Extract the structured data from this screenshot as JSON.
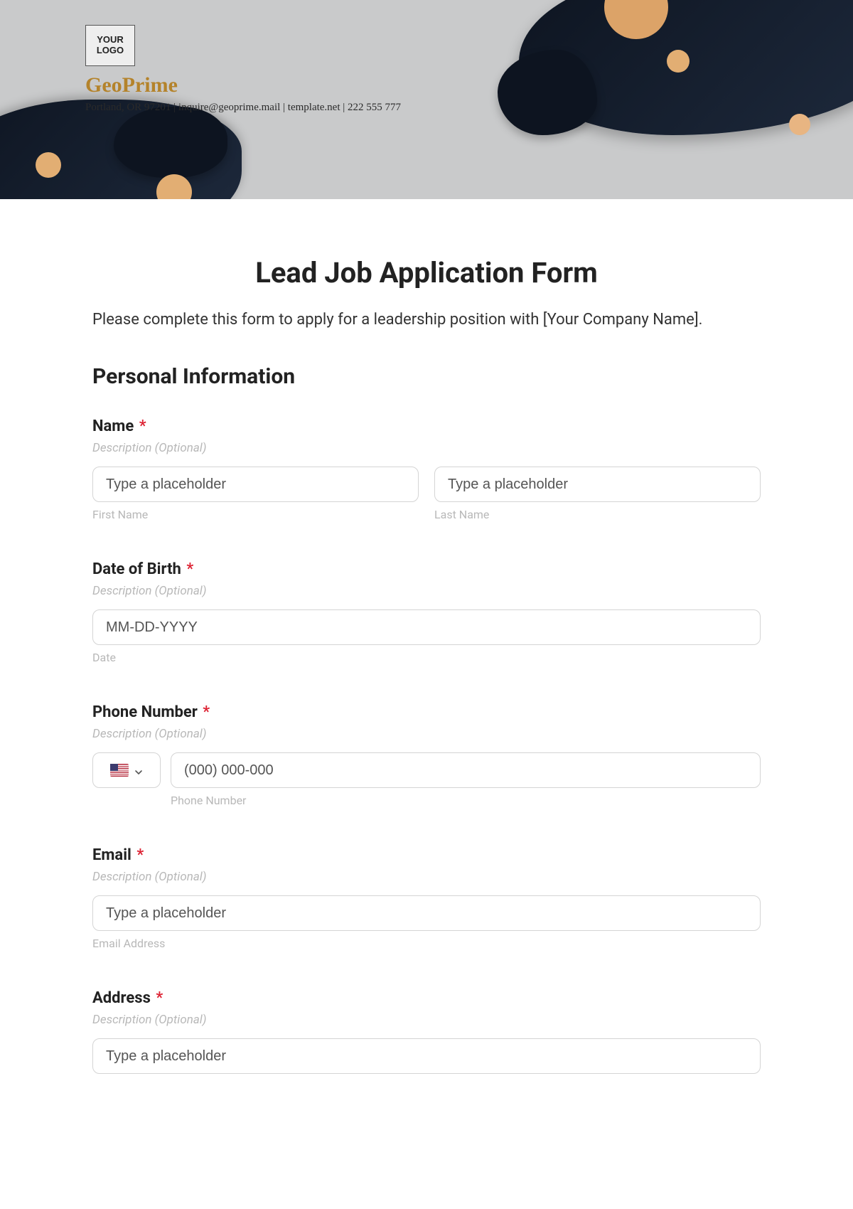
{
  "header": {
    "logo_text": "YOUR LOGO",
    "company_name": "GeoPrime",
    "meta_line": "Portland, OR 97201 | inquire@geoprime.mail | template.net | 222 555 777"
  },
  "form": {
    "title": "Lead Job Application Form",
    "intro": "Please complete this form to apply for a leadership position with [Your Company Name].",
    "section_personal": "Personal Information",
    "desc_optional": "Description (Optional)",
    "required_mark": "*",
    "name": {
      "label": "Name",
      "first_placeholder": "Type a placeholder",
      "first_sublabel": "First Name",
      "last_placeholder": "Type a placeholder",
      "last_sublabel": "Last Name"
    },
    "dob": {
      "label": "Date of Birth",
      "placeholder": "MM-DD-YYYY",
      "sublabel": "Date"
    },
    "phone": {
      "label": "Phone Number",
      "placeholder": "(000) 000-000",
      "sublabel": "Phone Number"
    },
    "email": {
      "label": "Email",
      "placeholder": "Type a placeholder",
      "sublabel": "Email Address"
    },
    "address": {
      "label": "Address",
      "placeholder": "Type a placeholder"
    }
  }
}
